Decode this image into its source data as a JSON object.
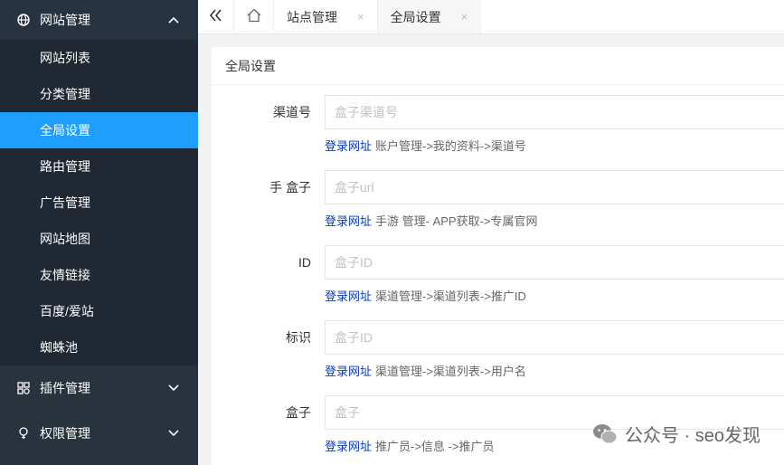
{
  "sidebar": {
    "site_manage": "网站管理",
    "items": [
      {
        "label": "网站列表"
      },
      {
        "label": "分类管理"
      },
      {
        "label": "全局设置"
      },
      {
        "label": "路由管理"
      },
      {
        "label": "广告管理"
      },
      {
        "label": "网站地图"
      },
      {
        "label": "友情链接"
      },
      {
        "label": "百度/爱站"
      },
      {
        "label": "蜘蛛池"
      }
    ],
    "plugin_manage": "插件管理",
    "permission_manage": "权限管理",
    "active_color": "#1e9fff"
  },
  "tabs": [
    {
      "label": "站点管理",
      "close": "×"
    },
    {
      "label": "全局设置",
      "close": "×"
    }
  ],
  "card": {
    "title": "全局设置"
  },
  "form": {
    "rows": [
      {
        "label": "渠道号",
        "placeholder": "盒子渠道号",
        "link": "登录网址",
        "help": "账户管理->我的资料->渠道号"
      },
      {
        "label": "手 盒子",
        "placeholder": "盒子url",
        "link": "登录网址",
        "help": "手游 管理- APP获取->专属官网"
      },
      {
        "label": "ID",
        "placeholder": "盒子ID",
        "link": "登录网址",
        "help": "渠道管理->渠道列表->推广ID"
      },
      {
        "label": "标识",
        "placeholder": "盒子ID",
        "link": "登录网址",
        "help": "渠道管理->渠道列表->用户名"
      },
      {
        "label": "盒子",
        "placeholder": "盒子",
        "link": "登录网址",
        "help": "推广员->信息 ->推广员"
      }
    ]
  },
  "watermark": "公众号 · seo发现"
}
